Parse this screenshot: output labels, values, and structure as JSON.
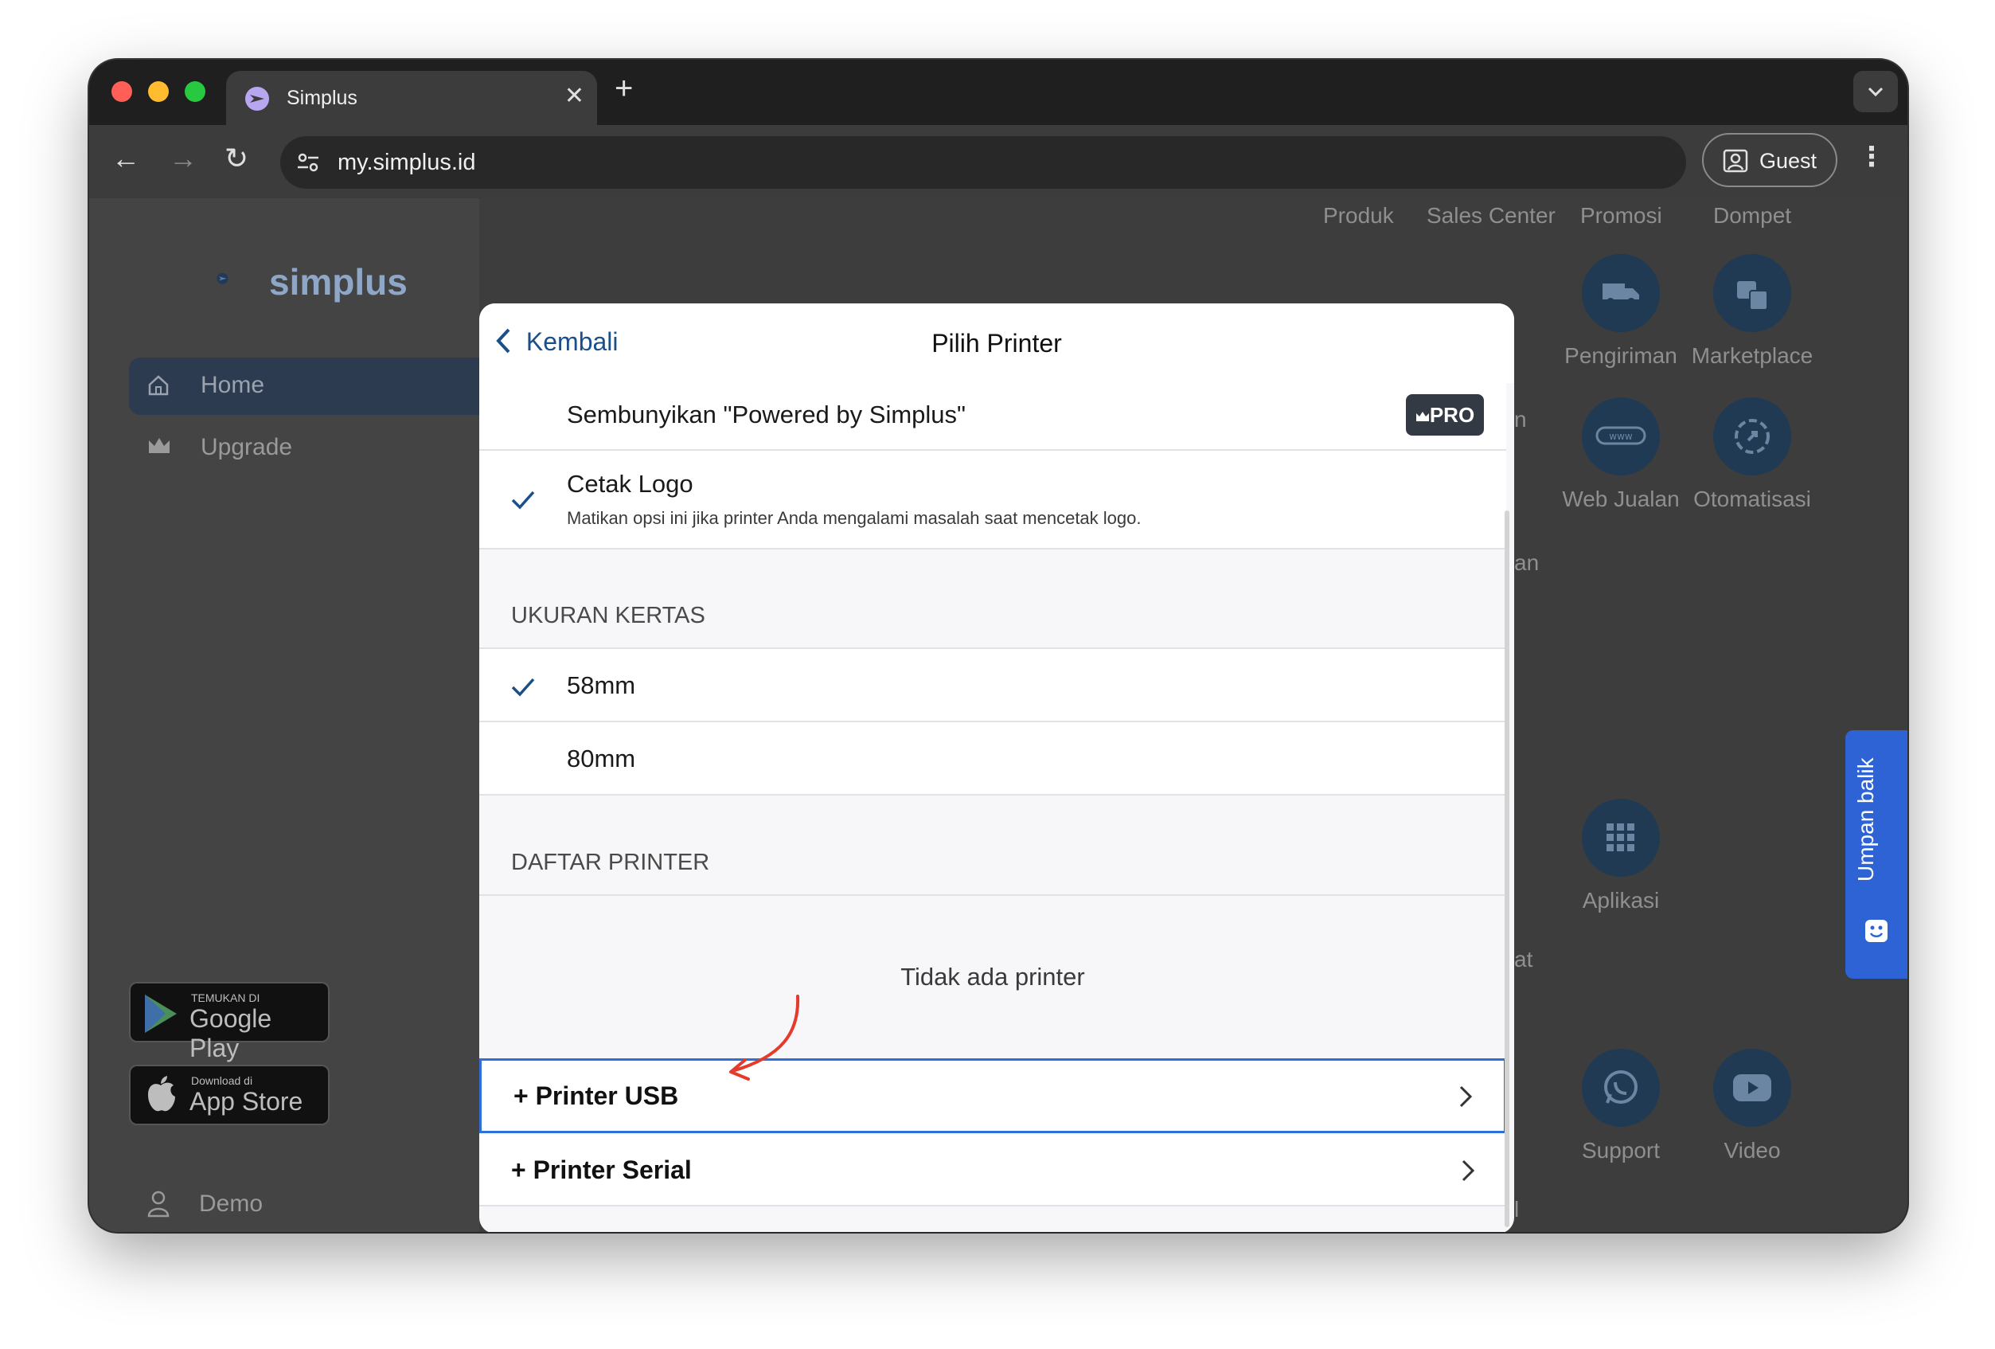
{
  "browser": {
    "tab_title": "Simplus",
    "tab_close": "✕",
    "new_tab": "+",
    "url": "my.simplus.id",
    "profile_label": "Guest",
    "menu": "⋮",
    "tab_dropdown": "⌄"
  },
  "sidebar": {
    "logo_text": "simplus",
    "items": [
      {
        "label": "Home",
        "icon": "home-icon"
      },
      {
        "label": "Upgrade",
        "icon": "crown-icon"
      }
    ],
    "google_play": {
      "small": "TEMUKAN DI",
      "big": "Google Play"
    },
    "app_store": {
      "small": "Download di",
      "big": "App Store"
    },
    "user": {
      "label": "Demo",
      "icon": "user-icon"
    }
  },
  "topnav": [
    "Produk",
    "Sales Center",
    "Promosi",
    "Dompet"
  ],
  "features": [
    {
      "label": "Pengiriman",
      "icon": "truck-icon"
    },
    {
      "label": "Marketplace",
      "icon": "shopping-bag-icon"
    },
    {
      "label": "Web Jualan",
      "icon": "web-icon"
    },
    {
      "label": "Otomatisasi",
      "icon": "automation-icon"
    },
    {
      "label": "Aplikasi",
      "icon": "grid-icon"
    },
    {
      "label": "Support",
      "icon": "whatsapp-icon"
    },
    {
      "label": "Video",
      "icon": "youtube-icon"
    }
  ],
  "partial_labels": [
    "n",
    "an",
    "at",
    "l"
  ],
  "feedback": {
    "label": "Umpan balik"
  },
  "modal": {
    "back_label": "Kembali",
    "title": "Pilih Printer",
    "hide_powered": "Sembunyikan \"Powered by Simplus\"",
    "pro_badge": "PRO",
    "print_logo": {
      "label": "Cetak Logo",
      "description": "Matikan opsi ini jika printer Anda mengalami masalah saat mencetak logo."
    },
    "paper_size_header": "UKURAN KERTAS",
    "paper_sizes": [
      {
        "label": "58mm",
        "selected": true
      },
      {
        "label": "80mm",
        "selected": false
      }
    ],
    "printer_list_header": "DAFTAR PRINTER",
    "empty_text": "Tidak ada printer",
    "add_usb": "+ Printer USB",
    "add_serial": "+ Printer Serial"
  },
  "colors": {
    "accent": "#1a4f8a",
    "feedback": "#2e63d6",
    "annotation_arrow": "#e53b2c"
  }
}
